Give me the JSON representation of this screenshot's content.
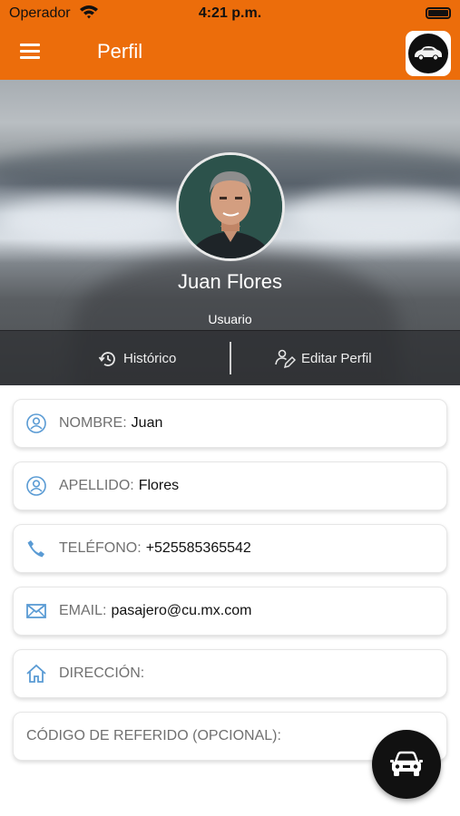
{
  "status_bar": {
    "carrier": "Operador",
    "time": "4:21 p.m."
  },
  "nav": {
    "title": "Perfil",
    "menu_icon": "hamburger-menu-icon",
    "logo_icon": "car-icon"
  },
  "profile": {
    "name": "Juan Flores",
    "role": "Usuario"
  },
  "actions": [
    {
      "label": "Histórico",
      "icon": "history-icon"
    },
    {
      "label": "Editar Perfil",
      "icon": "edit-profile-icon"
    }
  ],
  "fields": [
    {
      "label": "NOMBRE:",
      "value": "Juan",
      "icon": "user-icon"
    },
    {
      "label": "APELLIDO:",
      "value": "Flores",
      "icon": "user-icon"
    },
    {
      "label": "TELÉFONO:",
      "value": "+525585365542",
      "icon": "phone-icon"
    },
    {
      "label": "EMAIL:",
      "value": "pasajero@cu.mx.com",
      "icon": "mail-icon"
    },
    {
      "label": "DIRECCIÓN:",
      "value": "",
      "icon": "home-icon"
    },
    {
      "label": "CÓDIGO DE REFERIDO (OPCIONAL):",
      "value": ""
    }
  ],
  "colors": {
    "accent": "#ec6d0b",
    "icon_blue": "#5a9bd4"
  },
  "fab_icon": "car-icon"
}
